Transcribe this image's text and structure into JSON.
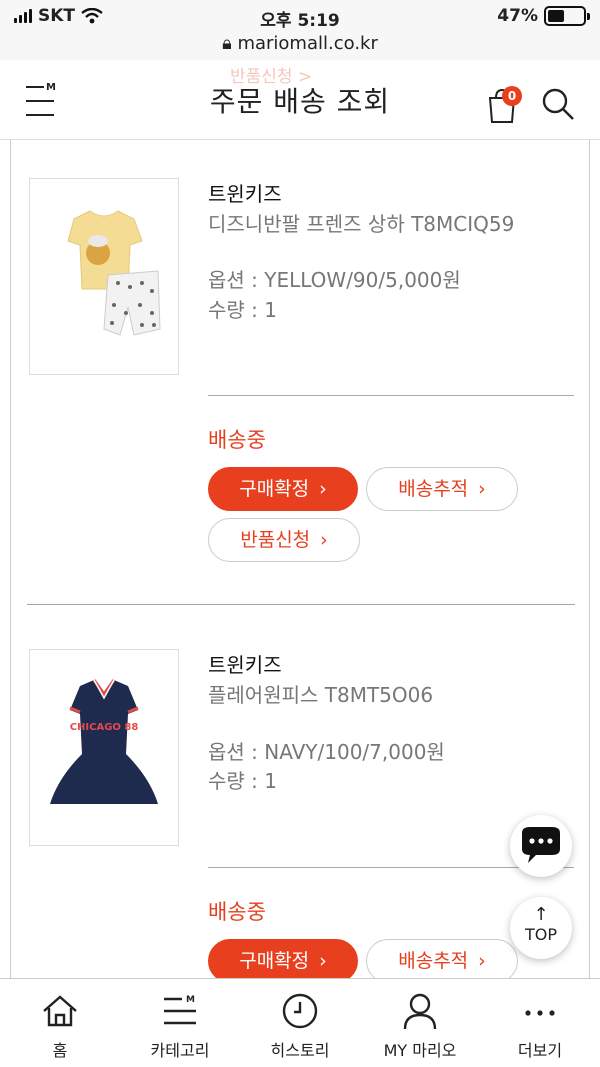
{
  "status_bar": {
    "carrier": "SKT",
    "time": "오후 5:19",
    "battery": "47%",
    "battery_level": 0.47,
    "url": "mariomall.co.kr"
  },
  "header": {
    "title": "주문 배송 조회",
    "cart_count": "0",
    "ghost_text": "반품신청 >"
  },
  "orders": [
    {
      "brand": "트윈키즈",
      "product": "디즈니반팔 프렌즈 상하 T8MCIQ59",
      "option": "옵션 : YELLOW/90/5,000원",
      "quantity": "수량 : 1",
      "status": "배송중",
      "buttons": [
        "구매확정",
        "배송추적",
        "반품신청"
      ]
    },
    {
      "brand": "트윈키즈",
      "product": "플레어원피스 T8MT5O06",
      "option": "옵션 : NAVY/100/7,000원",
      "quantity": "수량 : 1",
      "status": "배송중",
      "buttons": [
        "구매확정",
        "배송추적"
      ],
      "image_text": "CHICAGO 88"
    }
  ],
  "floating": {
    "top_label": "TOP"
  },
  "bottom_nav": [
    {
      "label": "홈",
      "icon": "home-icon"
    },
    {
      "label": "카테고리",
      "icon": "category-icon"
    },
    {
      "label": "히스토리",
      "icon": "history-icon"
    },
    {
      "label": "MY 마리오",
      "icon": "user-icon"
    },
    {
      "label": "더보기",
      "icon": "more-icon"
    }
  ],
  "colors": {
    "accent": "#e8401f",
    "text": "#222222",
    "muted": "#777777"
  }
}
